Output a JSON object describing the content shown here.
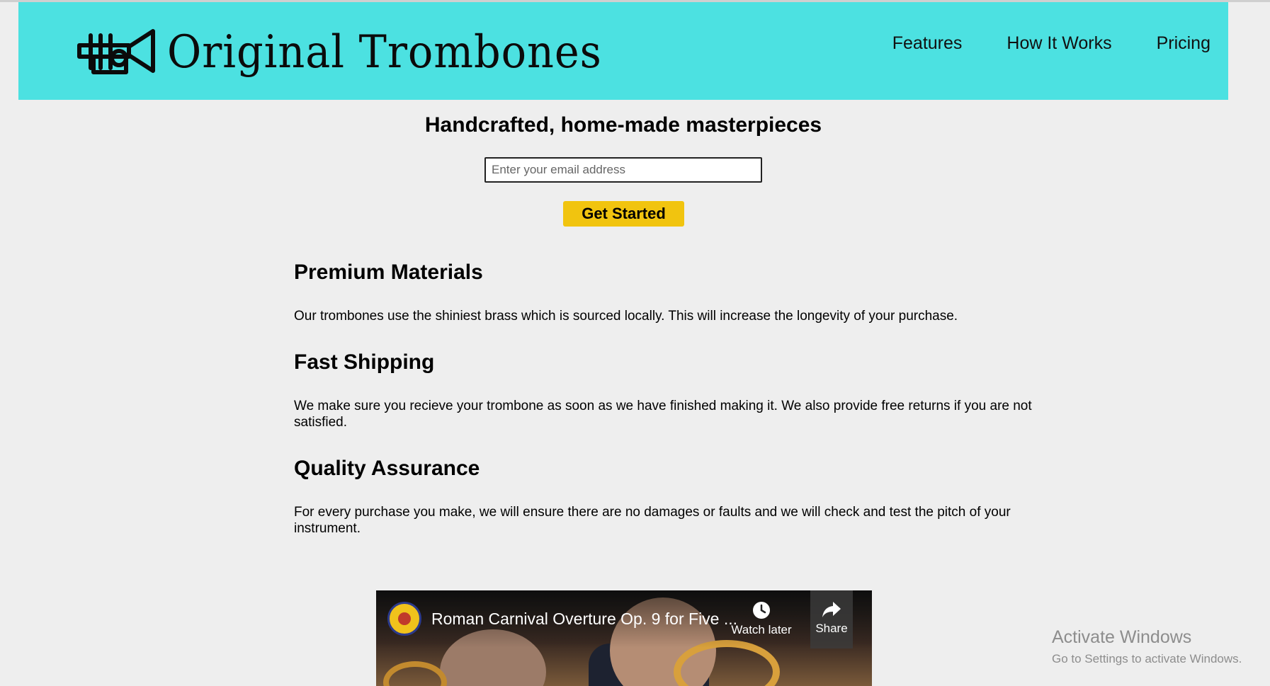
{
  "brand": {
    "name": "Original Trombones",
    "logo_icon": "trumpet-logo-icon"
  },
  "nav": {
    "items": [
      "Features",
      "How It Works",
      "Pricing"
    ]
  },
  "hero": {
    "title": "Handcrafted, home-made masterpieces",
    "email_placeholder": "Enter your email address",
    "cta_label": "Get Started"
  },
  "features": [
    {
      "title": "Premium Materials",
      "text": "Our trombones use the shiniest brass which is sourced locally. This will increase the longevity of your purchase."
    },
    {
      "title": "Fast Shipping",
      "text": "We make sure you recieve your trombone as soon as we have finished making it. We also provide free returns if you are not satisfied."
    },
    {
      "title": "Quality Assurance",
      "text": "For every purchase you make, we will ensure there are no damages or faults and we will check and test the pitch of your instrument."
    }
  ],
  "video": {
    "title": "Roman Carnival Overture Op. 9 for Five ...",
    "watch_later": "Watch later",
    "share": "Share"
  },
  "watermark": {
    "line1": "Activate Windows",
    "line2": "Go to Settings to activate Windows."
  },
  "colors": {
    "header_bg": "#4ce1e1",
    "cta_bg": "#f1c40f",
    "page_bg": "#eeeeee"
  }
}
